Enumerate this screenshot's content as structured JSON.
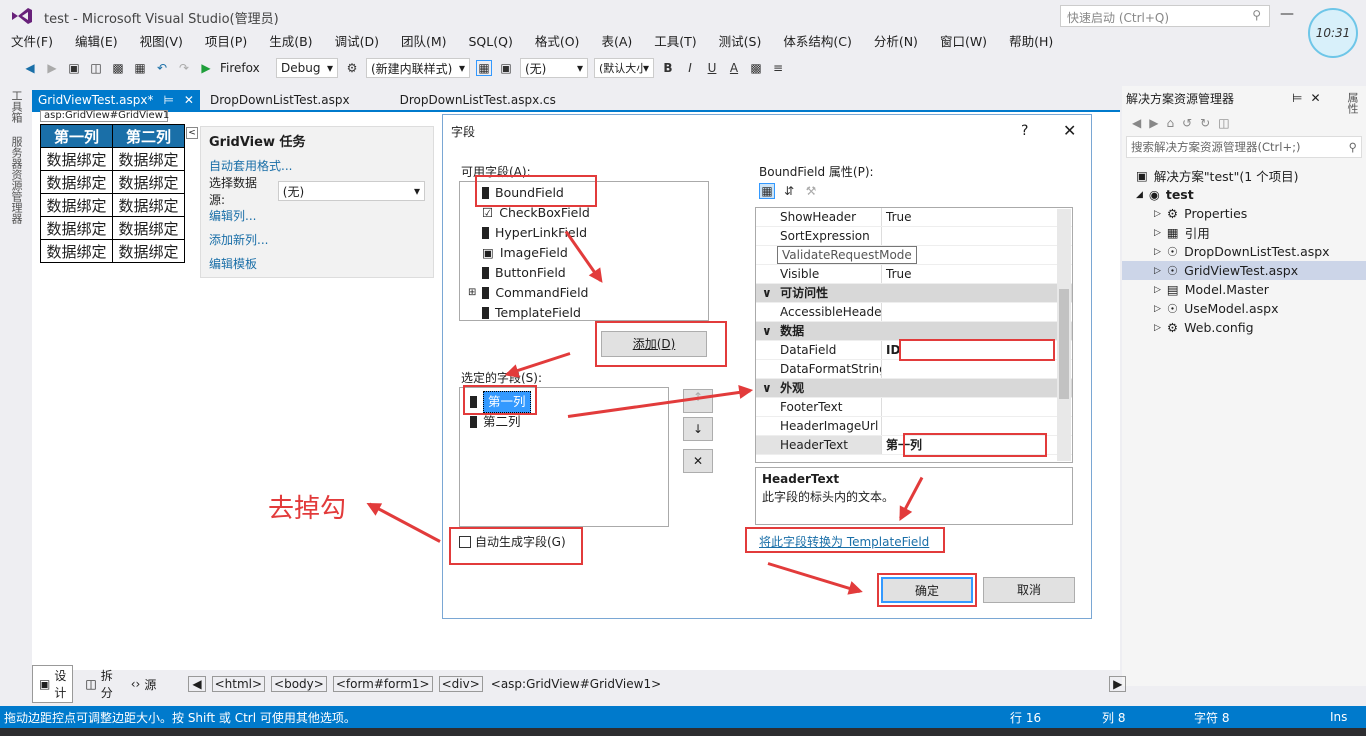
{
  "window": {
    "title": "test - Microsoft Visual Studio(管理员)",
    "quick_launch": "快速启动 (Ctrl+Q)",
    "clock": "10:31"
  },
  "menu": [
    "文件(F)",
    "编辑(E)",
    "视图(V)",
    "项目(P)",
    "生成(B)",
    "调试(D)",
    "团队(M)",
    "SQL(Q)",
    "格式(O)",
    "表(A)",
    "工具(T)",
    "测试(S)",
    "体系结构(C)",
    "分析(N)",
    "窗口(W)",
    "帮助(H)"
  ],
  "toolbar": {
    "browser": "Firefox",
    "config": "Debug",
    "style_combo": "(新建内联样式)",
    "none_combo": "(无)",
    "font_combo": "(默认大小)",
    "bold": "B",
    "italic": "I",
    "underline": "U"
  },
  "left_tools": {
    "toolbox": "工具箱",
    "server": "服务器资源管理器"
  },
  "tabs": {
    "active": "GridViewTest.aspx*",
    "tab2": "DropDownListTest.aspx",
    "tab3": "DropDownListTest.aspx.cs"
  },
  "designer": {
    "grid_tag": "asp:GridView#GridView1",
    "headers": [
      "第一列",
      "第二列"
    ],
    "rows": [
      [
        "数据绑定",
        "数据绑定"
      ],
      [
        "数据绑定",
        "数据绑定"
      ],
      [
        "数据绑定",
        "数据绑定"
      ],
      [
        "数据绑定",
        "数据绑定"
      ],
      [
        "数据绑定",
        "数据绑定"
      ]
    ],
    "tasks": {
      "title": "GridView 任务",
      "autoformat": "自动套用格式...",
      "datasource_label": "选择数据源:",
      "datasource_value": "(无)",
      "edit_columns": "编辑列...",
      "add_column": "添加新列...",
      "edit_templates": "编辑模板"
    }
  },
  "dialog": {
    "title": "字段",
    "help": "?",
    "available_label": "可用字段(A):",
    "available_fields": [
      "BoundField",
      "CheckBoxField",
      "HyperLinkField",
      "ImageField",
      "ButtonField",
      "CommandField",
      "TemplateField"
    ],
    "add_button": "添加(D)",
    "selected_label": "选定的字段(S):",
    "selected_fields": [
      "第一列",
      "第二列"
    ],
    "auto_generate": "自动生成字段(G)",
    "props_label": "BoundField 属性(P):",
    "props": [
      {
        "k": "ShowHeader",
        "v": "True"
      },
      {
        "k": "SortExpression",
        "v": ""
      },
      {
        "k": "",
        "v": "herit"
      },
      {
        "k": "Visible",
        "v": "True"
      },
      {
        "cat": "可访问性"
      },
      {
        "k": "AccessibleHeaderTex",
        "v": ""
      },
      {
        "cat": "数据"
      },
      {
        "k": "DataField",
        "v": "ID"
      },
      {
        "k": "DataFormatString",
        "v": ""
      },
      {
        "cat": "外观"
      },
      {
        "k": "FooterText",
        "v": ""
      },
      {
        "k": "HeaderImageUrl",
        "v": ""
      },
      {
        "k": "HeaderText",
        "v": "第一列"
      }
    ],
    "tooltip": "ValidateRequestMode",
    "desc_title": "HeaderText",
    "desc_text": "此字段的标头内的文本。",
    "convert_link": "将此字段转换为 TemplateField",
    "ok": "确定",
    "cancel": "取消"
  },
  "annotation": "去掉勾",
  "solution": {
    "title": "解决方案资源管理器",
    "search": "搜索解决方案资源管理器(Ctrl+;)",
    "root": "解决方案\"test\"(1 个项目)",
    "project": "test",
    "items": [
      "Properties",
      "引用",
      "DropDownListTest.aspx",
      "GridViewTest.aspx",
      "Model.Master",
      "UseModel.aspx",
      "Web.config"
    ],
    "side_tab": "属性"
  },
  "bottom": {
    "design": "设计",
    "split": "拆分",
    "source": "源",
    "crumbs": [
      "<html>",
      "<body>",
      "<form#form1>",
      "<div>",
      "<asp:GridView#GridView1>"
    ]
  },
  "status": {
    "message": "拖动边距控点可调整边距大小。按 Shift 或 Ctrl 可使用其他选项。",
    "line": "行 16",
    "col": "列 8",
    "char": "字符 8",
    "ins": "Ins"
  }
}
